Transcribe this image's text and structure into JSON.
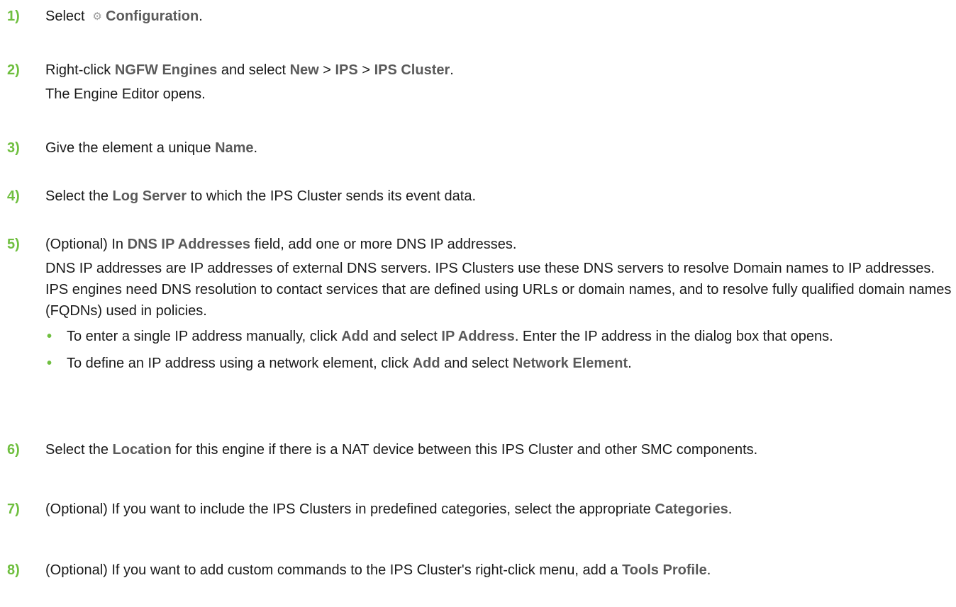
{
  "steps": [
    {
      "num": "1)",
      "t1": "Select",
      "b1": "Configuration",
      "t2": "."
    },
    {
      "num": "2)",
      "t1": "Right-click",
      "b1": "NGFW Engines",
      "t2": "and select",
      "b2": "New",
      "t3": ">",
      "b3": "IPS",
      "t4": ">",
      "b4": "IPS Cluster",
      "t5": ".",
      "sub": "The Engine Editor opens."
    },
    {
      "num": "3)",
      "t1": "Give the element a unique",
      "b1": "Name",
      "t2": "."
    },
    {
      "num": "4)",
      "t1": "Select the",
      "b1": "Log Server",
      "t2": "to which the IPS Cluster sends its event data."
    },
    {
      "num": "5)",
      "t1": "(Optional) In",
      "b1": "DNS IP Addresses",
      "t2": "field, add one or more DNS IP addresses.",
      "sub": "DNS IP addresses are IP addresses of external DNS servers. IPS Clusters use these DNS servers to resolve Domain names to IP addresses. IPS engines need DNS resolution to contact services that are defined using URLs or domain names, and to resolve fully qualified domain names (FQDNs) used in policies.",
      "bullets": [
        {
          "t1": "To enter a single IP address manually, click",
          "b1": "Add",
          "t2": "and select",
          "b2": "IP Address",
          "t3": ". Enter the IP address in the dialog box that opens."
        },
        {
          "t1": "To define an IP address using a network element, click",
          "b1": "Add",
          "t2": "and select",
          "b2": "Network Element",
          "t3": "."
        }
      ]
    },
    {
      "num": "6)",
      "t1": "Select the",
      "b1": "Location",
      "t2": "for this engine if there is a NAT device between this IPS Cluster and other SMC components."
    },
    {
      "num": "7)",
      "t1": "(Optional) If you want to include the IPS Clusters in predefined categories, select the appropriate",
      "b1": "Categories",
      "t2": "."
    },
    {
      "num": "8)",
      "t1": "(Optional) If you want to add custom commands to the IPS Cluster's right-click menu, add a",
      "b1": "Tools Profile",
      "t2": "."
    }
  ],
  "bullet_glyph": "•",
  "icons": {
    "configuration": "gear-icon"
  },
  "colors": {
    "step_number": "#6fbf3f",
    "bold_ui_text": "#5a5a5a",
    "text": "#1a1a1a"
  }
}
